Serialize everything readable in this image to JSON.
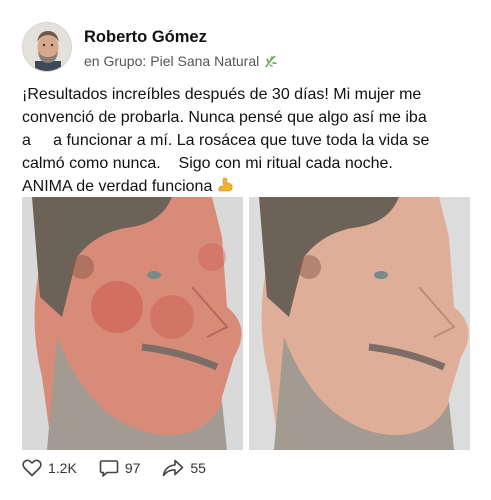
{
  "post": {
    "author": "Roberto Gómez",
    "group_prefix": "en Grupo:",
    "group_name": "Piel Sana Natural",
    "text_lines": [
      "¡Resultados increíbles después de 30 días! Mi mujer me",
      "convenció de probarla. Nunca pensé que algo así me iba",
      "a     a funcionar a mí. La rosácea que tuve toda la vida se",
      "calmó como nunca.    Sigo con mi ritual cada noche.",
      "ANIMA de verdad funciona"
    ]
  },
  "icons": {
    "leaf": "herb-leaf-icon",
    "emoji": "flexed-biceps-icon",
    "like": "heart-outline-icon",
    "comment": "speech-bubble-icon",
    "share": "share-arrow-icon"
  },
  "photos": {
    "before": "man-profile-with-redness",
    "after": "man-profile-clear-skin"
  },
  "actions": {
    "likes": "1.2K",
    "comments": "97",
    "shares": "55"
  },
  "colors": {
    "text": "#111111",
    "meta": "#555555",
    "leaf": "#6aa84f",
    "biceps": "#f2b233"
  }
}
